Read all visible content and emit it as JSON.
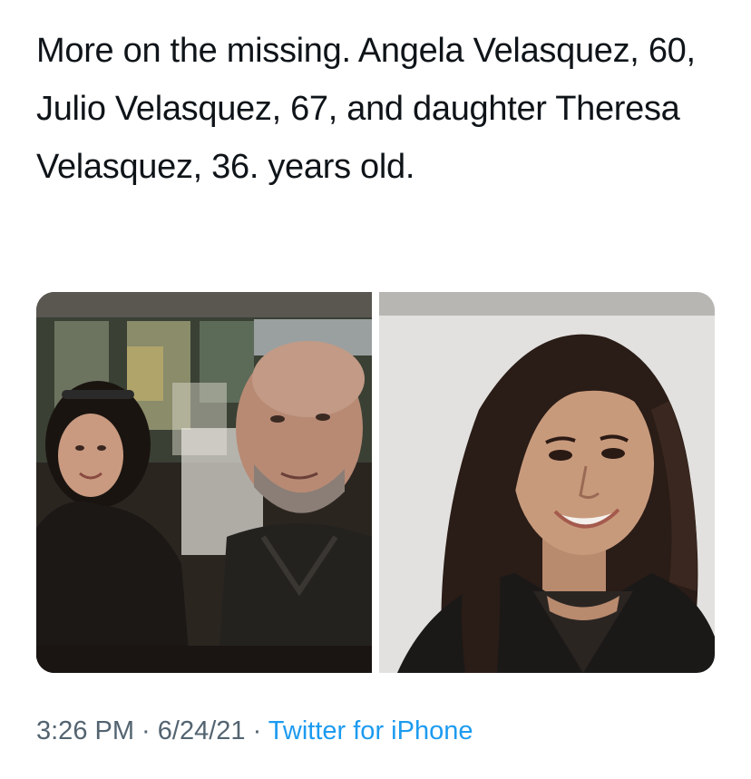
{
  "tweet": {
    "text": "More on the missing. Angela Velasquez, 60, Julio Velasquez, 67, and daughter Theresa Velasquez, 36. years old."
  },
  "media": [
    {
      "kind": "photo",
      "depicts": "couple-at-restaurant"
    },
    {
      "kind": "photo",
      "depicts": "woman-portrait"
    }
  ],
  "meta": {
    "time": "3:26 PM",
    "sep1": " · ",
    "date": "6/24/21",
    "sep2": " · ",
    "source": "Twitter for iPhone"
  },
  "colors": {
    "text": "#0f1419",
    "meta": "#536471",
    "link": "#1d9bf0"
  }
}
